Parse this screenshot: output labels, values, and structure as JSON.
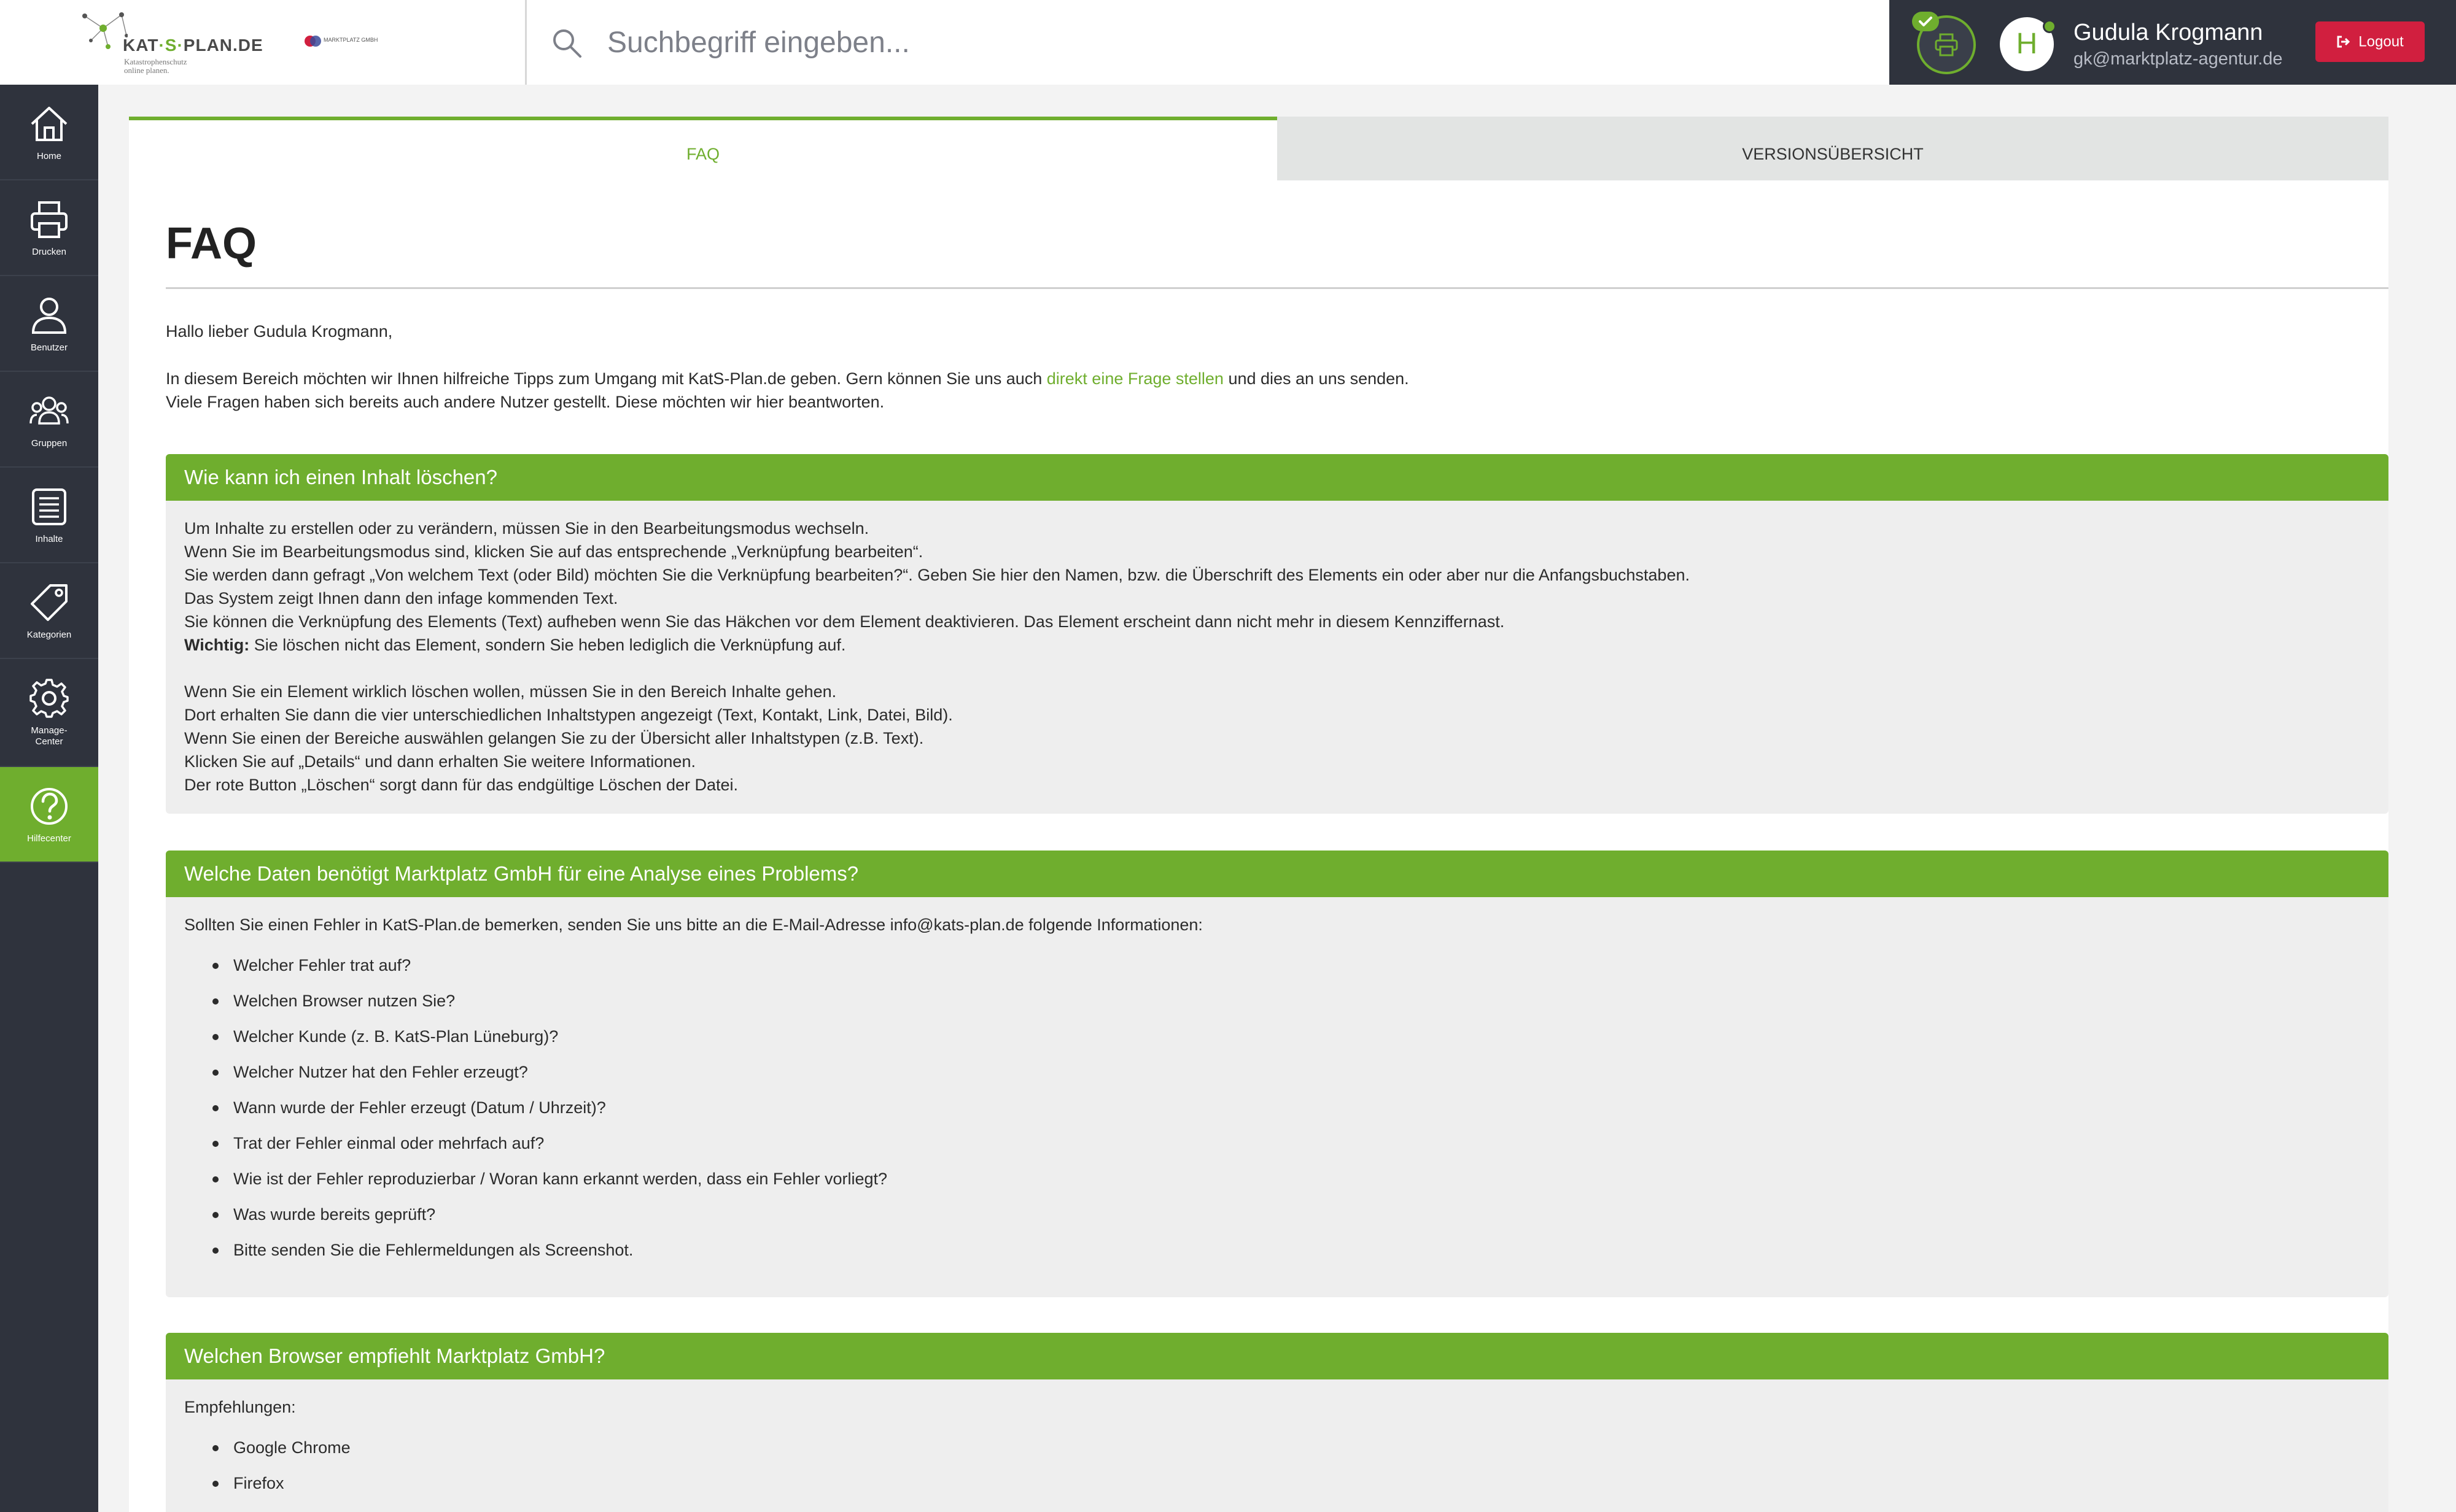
{
  "header": {
    "logo_name_part1": "KAT",
    "logo_name_s": "·S·",
    "logo_name_part2": "PLAN.DE",
    "logo_tagline_1": "Katastrophenschutz",
    "logo_tagline_2": "online planen.",
    "partner_logo_text": "MARKTPLATZ GMBH",
    "search_placeholder": "Suchbegriff eingeben...",
    "avatar_letter": "H",
    "user_name": "Gudula Krogmann",
    "user_email": "gk@marktplatz-agentur.de",
    "logout_label": "Logout"
  },
  "sidebar": {
    "items": [
      {
        "label": "Home",
        "icon": "home-icon"
      },
      {
        "label": "Drucken",
        "icon": "printer-icon"
      },
      {
        "label": "Benutzer",
        "icon": "user-icon"
      },
      {
        "label": "Gruppen",
        "icon": "group-icon"
      },
      {
        "label": "Inhalte",
        "icon": "list-icon"
      },
      {
        "label": "Kategorien",
        "icon": "tag-icon"
      },
      {
        "label": "Manage-",
        "label2": "Center",
        "icon": "gear-icon"
      },
      {
        "label": "Hilfecenter",
        "icon": "help-icon",
        "active": true
      }
    ]
  },
  "tabs": {
    "faq": "FAQ",
    "version": "VERSIONSÜBERSICHT"
  },
  "page": {
    "title": "FAQ",
    "greeting": "Hallo lieber Gudula Krogmann,",
    "intro1_a": "In diesem Bereich möchten wir Ihnen hilfreiche Tipps zum Umgang mit KatS-Plan.de geben. Gern können Sie uns auch ",
    "intro1_link": "direkt eine Frage stellen",
    "intro1_b": " und dies an uns senden.",
    "intro2": "Viele Fragen haben sich bereits auch andere Nutzer gestellt. Diese möchten wir hier beantworten."
  },
  "faq": [
    {
      "question": "Wie kann ich einen Inhalt löschen?",
      "lines1": [
        "Um Inhalte zu erstellen oder zu verändern, müssen Sie in den Bearbeitungsmodus wechseln.",
        "Wenn Sie im Bearbeitungsmodus sind, klicken Sie auf das entsprechende „Verknüpfung bearbeiten“.",
        "Sie werden dann gefragt „Von welchem Text (oder Bild) möchten Sie die Verknüpfung bearbeiten?“. Geben Sie hier den Namen, bzw. die Überschrift des Elements ein oder aber nur die Anfangsbuchstaben.",
        "Das System zeigt Ihnen dann den infage kommenden Text.",
        "Sie können die Verknüpfung des Elements (Text) aufheben wenn Sie das Häkchen vor dem Element deaktivieren. Das Element erscheint dann nicht mehr in diesem Kennziffernast."
      ],
      "warning_label": "Wichtig:",
      "warning_text": " Sie löschen nicht das Element, sondern Sie heben lediglich die Verknüpfung auf.",
      "lines2": [
        "Wenn Sie ein Element wirklich löschen wollen, müssen Sie in den Bereich Inhalte gehen.",
        "Dort erhalten Sie dann die vier unterschiedlichen Inhaltstypen angezeigt (Text, Kontakt, Link, Datei, Bild).",
        "Wenn Sie einen der Bereiche auswählen gelangen Sie zu der Übersicht aller Inhaltstypen (z.B. Text).",
        "Klicken Sie auf „Details“ und dann erhalten Sie weitere Informationen.",
        "Der rote Button „Löschen“ sorgt dann für das endgültige Löschen der Datei."
      ]
    },
    {
      "question": "Welche Daten benötigt Marktplatz GmbH für eine Analyse eines Problems?",
      "intro": "Sollten Sie einen Fehler in KatS-Plan.de bemerken, senden Sie uns bitte an die E-Mail-Adresse info@kats-plan.de folgende Informationen:",
      "items": [
        "Welcher Fehler trat auf?",
        "Welchen Browser nutzen Sie?",
        "Welcher Kunde (z. B. KatS-Plan Lüneburg)?",
        "Welcher Nutzer hat den Fehler erzeugt?",
        "Wann wurde der Fehler erzeugt (Datum / Uhrzeit)?",
        "Trat der Fehler einmal oder mehrfach auf?",
        "Wie ist der Fehler reproduzierbar / Woran kann erkannt werden, dass ein Fehler vorliegt?",
        "Was wurde bereits geprüft?",
        "Bitte senden Sie die Fehlermeldungen als Screenshot."
      ]
    },
    {
      "question": "Welchen Browser empfiehlt Marktplatz GmbH?",
      "intro": "Empfehlungen:",
      "items": [
        "Google Chrome",
        "Firefox"
      ]
    }
  ],
  "colors": {
    "accent": "#6fae2e",
    "sidebar": "#2f333d",
    "logout": "#d11f3f"
  }
}
